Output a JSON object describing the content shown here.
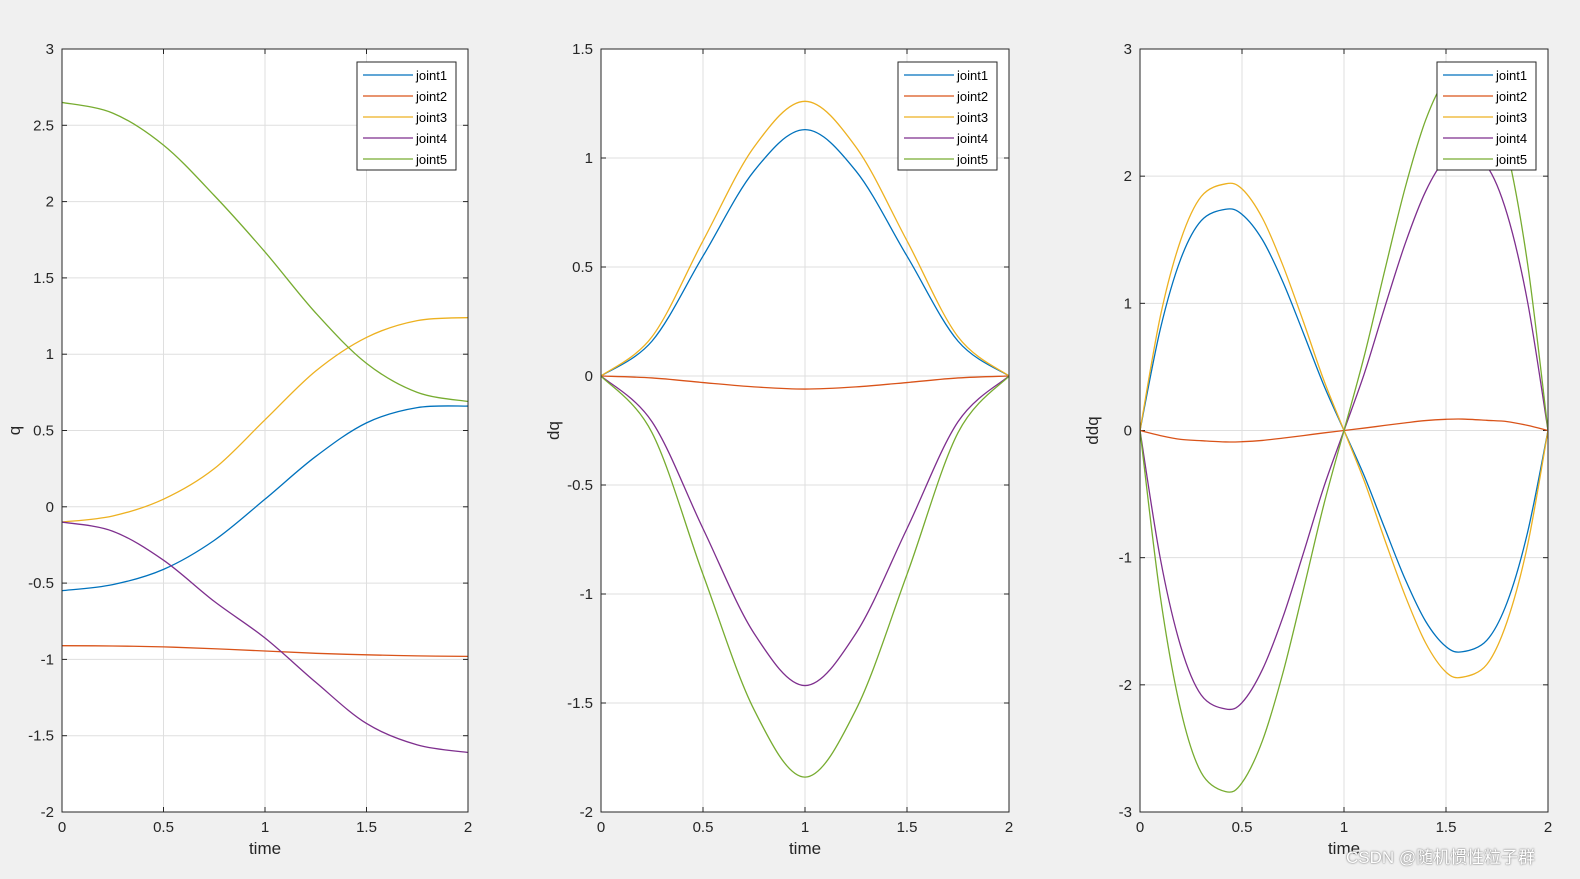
{
  "watermark": "CSDN @随机惯性粒子群",
  "series_colors": [
    "#0072BD",
    "#D95319",
    "#EDB120",
    "#7E2F8E",
    "#77AC30"
  ],
  "chart_data": [
    {
      "type": "line",
      "xlabel": "time",
      "ylabel": "q",
      "xlim": [
        0,
        2
      ],
      "ylim": [
        -2,
        3
      ],
      "xticks": [
        0,
        0.5,
        1,
        1.5,
        2
      ],
      "yticks": [
        -2,
        -1.5,
        -1,
        -0.5,
        0,
        0.5,
        1,
        1.5,
        2,
        2.5,
        3
      ],
      "grid": true,
      "legend": "top-right",
      "series": [
        {
          "name": "joint1",
          "x": [
            0,
            0.25,
            0.5,
            0.75,
            1,
            1.25,
            1.5,
            1.75,
            2
          ],
          "values": [
            -0.55,
            -0.51,
            -0.41,
            -0.22,
            0.05,
            0.33,
            0.55,
            0.65,
            0.66
          ]
        },
        {
          "name": "joint2",
          "x": [
            0,
            0.25,
            0.5,
            0.75,
            1,
            1.25,
            1.5,
            1.75,
            2
          ],
          "values": [
            -0.91,
            -0.912,
            -0.918,
            -0.93,
            -0.945,
            -0.96,
            -0.97,
            -0.977,
            -0.98
          ]
        },
        {
          "name": "joint3",
          "x": [
            0,
            0.25,
            0.5,
            0.75,
            1,
            1.25,
            1.5,
            1.75,
            2
          ],
          "values": [
            -0.1,
            -0.06,
            0.05,
            0.25,
            0.57,
            0.89,
            1.11,
            1.22,
            1.24
          ]
        },
        {
          "name": "joint4",
          "x": [
            0,
            0.25,
            0.5,
            0.75,
            1,
            1.25,
            1.5,
            1.75,
            2
          ],
          "values": [
            -0.1,
            -0.16,
            -0.35,
            -0.62,
            -0.86,
            -1.15,
            -1.42,
            -1.56,
            -1.61
          ]
        },
        {
          "name": "joint5",
          "x": [
            0,
            0.25,
            0.5,
            0.75,
            1,
            1.25,
            1.5,
            1.75,
            2
          ],
          "values": [
            2.65,
            2.58,
            2.37,
            2.04,
            1.67,
            1.27,
            0.94,
            0.75,
            0.69
          ]
        }
      ]
    },
    {
      "type": "line",
      "xlabel": "time",
      "ylabel": "dq",
      "xlim": [
        0,
        2
      ],
      "ylim": [
        -2,
        1.5
      ],
      "xticks": [
        0,
        0.5,
        1,
        1.5,
        2
      ],
      "yticks": [
        -2,
        -1.5,
        -1,
        -0.5,
        0,
        0.5,
        1,
        1.5
      ],
      "grid": true,
      "legend": "top-right",
      "series": [
        {
          "name": "joint1",
          "x": [
            0,
            0.25,
            0.5,
            0.75,
            1,
            1.25,
            1.5,
            1.75,
            2
          ],
          "values": [
            0,
            0.16,
            0.55,
            0.94,
            1.13,
            0.94,
            0.55,
            0.16,
            0
          ]
        },
        {
          "name": "joint2",
          "x": [
            0,
            0.25,
            0.5,
            0.75,
            1,
            1.25,
            1.5,
            1.75,
            2
          ],
          "values": [
            0,
            -0.009,
            -0.03,
            -0.05,
            -0.06,
            -0.05,
            -0.03,
            -0.009,
            0
          ]
        },
        {
          "name": "joint3",
          "x": [
            0,
            0.25,
            0.5,
            0.75,
            1,
            1.25,
            1.5,
            1.75,
            2
          ],
          "values": [
            0,
            0.18,
            0.62,
            1.05,
            1.26,
            1.05,
            0.62,
            0.18,
            0
          ]
        },
        {
          "name": "joint4",
          "x": [
            0,
            0.25,
            0.5,
            0.75,
            1,
            1.25,
            1.5,
            1.75,
            2
          ],
          "values": [
            0,
            -0.21,
            -0.7,
            -1.18,
            -1.42,
            -1.18,
            -0.7,
            -0.21,
            0
          ]
        },
        {
          "name": "joint5",
          "x": [
            0,
            0.25,
            0.5,
            0.75,
            1,
            1.25,
            1.5,
            1.75,
            2
          ],
          "values": [
            0,
            -0.26,
            -0.91,
            -1.53,
            -1.84,
            -1.53,
            -0.91,
            -0.26,
            0
          ]
        }
      ]
    },
    {
      "type": "line",
      "xlabel": "time",
      "ylabel": "ddq",
      "xlim": [
        0,
        2
      ],
      "ylim": [
        -3,
        3
      ],
      "xticks": [
        0,
        0.5,
        1,
        1.5,
        2
      ],
      "yticks": [
        -3,
        -2,
        -1,
        0,
        1,
        2,
        3
      ],
      "grid": true,
      "legend": "top-right",
      "series": [
        {
          "name": "joint1",
          "x": [
            0,
            0.1,
            0.2,
            0.3,
            0.42,
            0.5,
            0.6,
            0.7,
            0.8,
            0.9,
            1,
            1.1,
            1.2,
            1.3,
            1.4,
            1.5,
            1.58,
            1.7,
            1.8,
            1.9,
            2
          ],
          "values": [
            0,
            0.8,
            1.35,
            1.65,
            1.74,
            1.7,
            1.5,
            1.17,
            0.77,
            0.36,
            0,
            -0.36,
            -0.77,
            -1.17,
            -1.5,
            -1.7,
            -1.74,
            -1.65,
            -1.35,
            -0.8,
            0
          ]
        },
        {
          "name": "joint2",
          "x": [
            0,
            0.1,
            0.2,
            0.3,
            0.42,
            0.5,
            0.6,
            0.7,
            0.8,
            0.9,
            1,
            1.1,
            1.2,
            1.3,
            1.4,
            1.5,
            1.58,
            1.7,
            1.8,
            1.9,
            2
          ],
          "values": [
            0,
            -0.04,
            -0.07,
            -0.08,
            -0.09,
            -0.088,
            -0.078,
            -0.06,
            -0.04,
            -0.019,
            0,
            0.019,
            0.04,
            0.06,
            0.078,
            0.088,
            0.09,
            0.08,
            0.07,
            0.04,
            0
          ]
        },
        {
          "name": "joint3",
          "x": [
            0,
            0.1,
            0.2,
            0.3,
            0.42,
            0.5,
            0.6,
            0.7,
            0.8,
            0.9,
            1,
            1.1,
            1.2,
            1.3,
            1.4,
            1.5,
            1.58,
            1.7,
            1.8,
            1.9,
            2
          ],
          "values": [
            0,
            0.9,
            1.5,
            1.84,
            1.94,
            1.9,
            1.67,
            1.3,
            0.86,
            0.4,
            0,
            -0.4,
            -0.86,
            -1.3,
            -1.67,
            -1.9,
            -1.94,
            -1.84,
            -1.5,
            -0.9,
            0
          ]
        },
        {
          "name": "joint4",
          "x": [
            0,
            0.1,
            0.2,
            0.3,
            0.42,
            0.5,
            0.6,
            0.7,
            0.8,
            0.9,
            1,
            1.1,
            1.2,
            1.3,
            1.4,
            1.5,
            1.58,
            1.7,
            1.8,
            1.9,
            2
          ],
          "values": [
            0,
            -1.01,
            -1.7,
            -2.08,
            -2.19,
            -2.14,
            -1.88,
            -1.47,
            -0.97,
            -0.45,
            0,
            0.45,
            0.97,
            1.47,
            1.88,
            2.14,
            2.19,
            2.08,
            1.7,
            1.01,
            0
          ]
        },
        {
          "name": "joint5",
          "x": [
            0,
            0.1,
            0.2,
            0.3,
            0.42,
            0.5,
            0.6,
            0.7,
            0.8,
            0.9,
            1,
            1.1,
            1.2,
            1.3,
            1.4,
            1.5,
            1.58,
            1.7,
            1.8,
            1.9,
            2
          ],
          "values": [
            0,
            -1.31,
            -2.2,
            -2.69,
            -2.84,
            -2.77,
            -2.44,
            -1.91,
            -1.26,
            -0.59,
            0,
            0.59,
            1.26,
            1.91,
            2.44,
            2.77,
            2.84,
            2.69,
            2.2,
            1.31,
            0
          ]
        }
      ]
    }
  ]
}
